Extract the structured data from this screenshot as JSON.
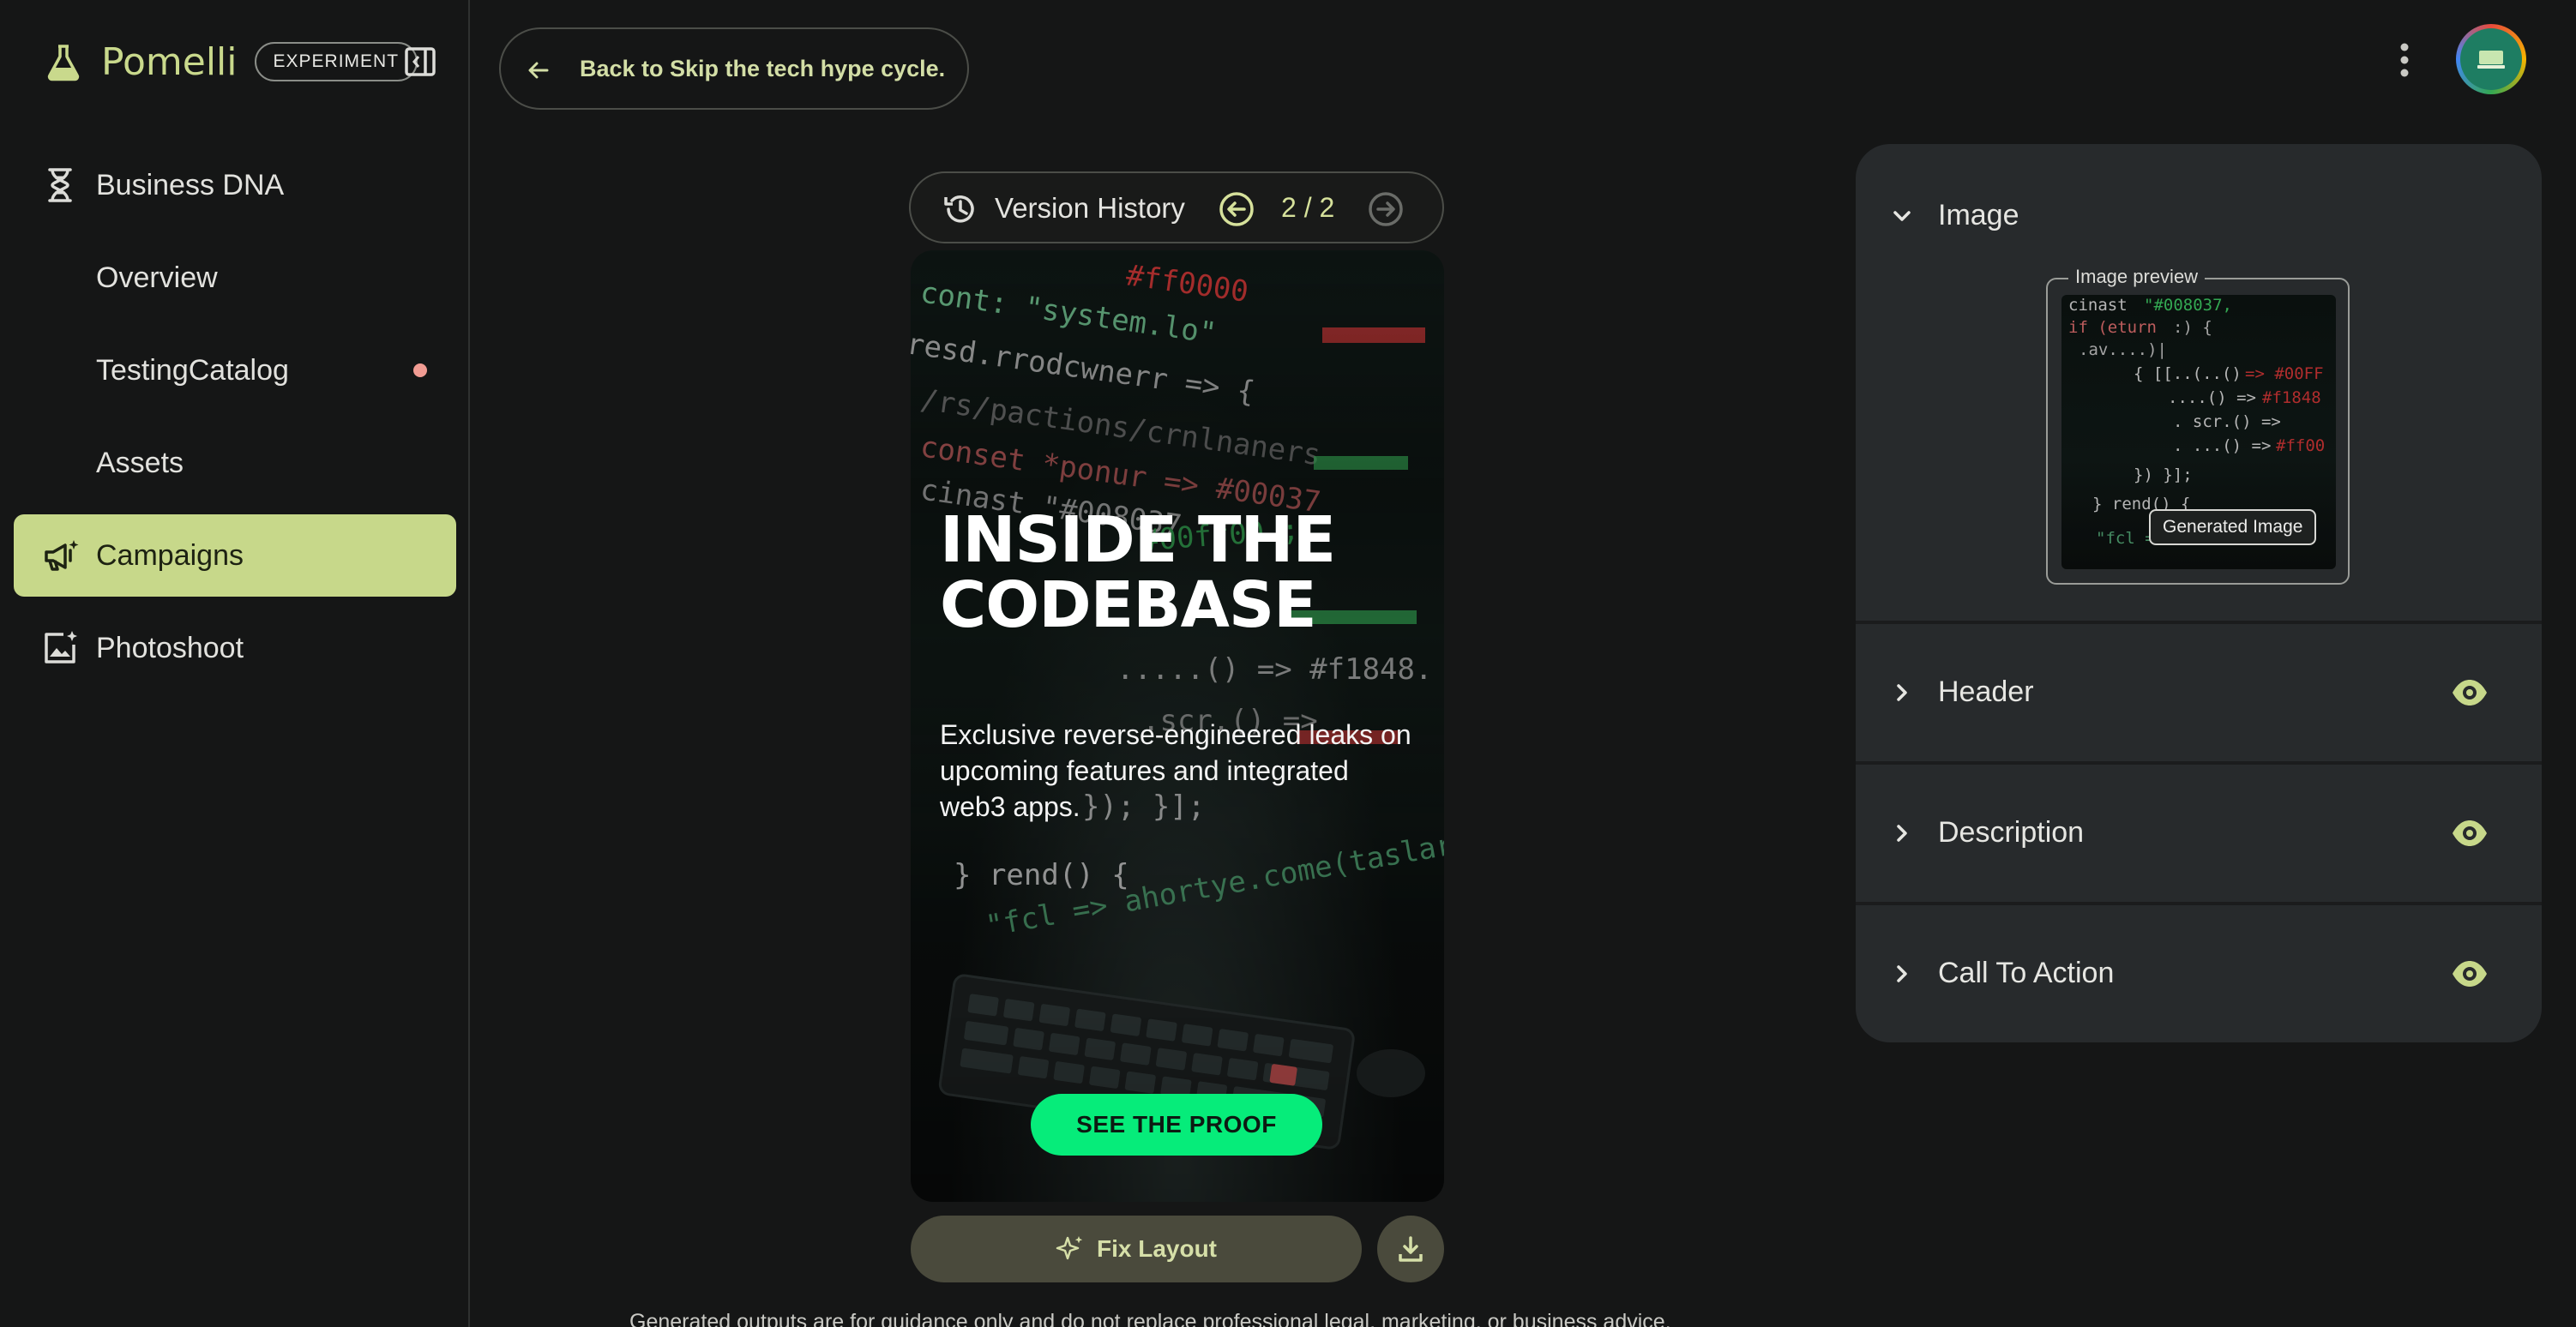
{
  "brand": {
    "name": "Pomelli",
    "badge": "EXPERIMENT"
  },
  "sidebar": {
    "items": [
      {
        "label": "Business DNA",
        "icon": "dna-icon"
      },
      {
        "label": "Overview"
      },
      {
        "label": "TestingCatalog",
        "has_dot": true
      },
      {
        "label": "Assets"
      },
      {
        "label": "Campaigns",
        "icon": "campaign-icon",
        "active": true
      },
      {
        "label": "Photoshoot",
        "icon": "photoshoot-icon"
      }
    ]
  },
  "topbar": {
    "back_label": "Back to Skip the tech hype cycle."
  },
  "version": {
    "label": "Version History",
    "count": "2 / 2"
  },
  "creative": {
    "headline_line1": "INSIDE THE",
    "headline_line2": "CODEBASE",
    "description": "Exclusive reverse-engineered leaks on upcoming features and integrated web3 apps.",
    "cta": "SEE THE PROOF"
  },
  "actions": {
    "fix_layout": "Fix Layout"
  },
  "disclaimer": "Generated outputs are for guidance only and do not replace professional legal, marketing, or business advice.",
  "panel": {
    "sections": [
      {
        "title": "Image",
        "expanded": true,
        "preview_label": "Image preview",
        "tag": "Generated Image"
      },
      {
        "title": "Header",
        "visible": true
      },
      {
        "title": "Description",
        "visible": true
      },
      {
        "title": "Call To Action",
        "visible": true
      }
    ]
  },
  "colors": {
    "accent": "#c7d88a",
    "cta_green": "#06ec7a",
    "background": "#151616",
    "panel": "#272a2c"
  }
}
